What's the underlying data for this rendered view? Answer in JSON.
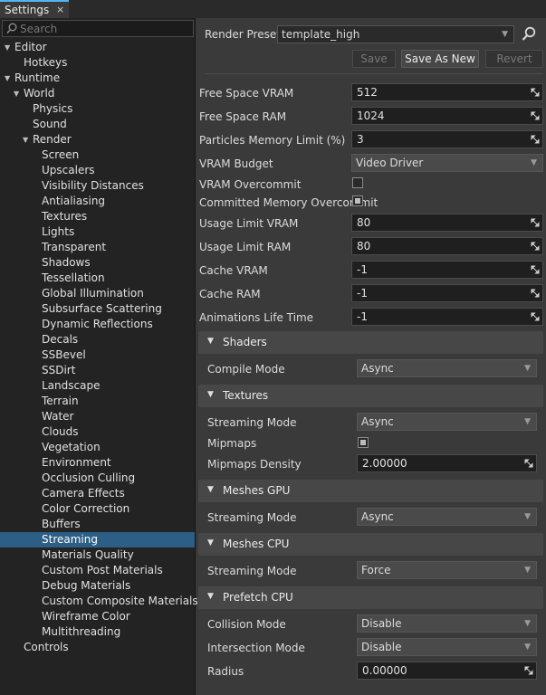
{
  "window": {
    "tab_title": "Settings",
    "tab_close": "×"
  },
  "search": {
    "placeholder": "Search"
  },
  "tree": [
    {
      "label": "Editor",
      "level": 0,
      "arrow": "down"
    },
    {
      "label": "Hotkeys",
      "level": 1
    },
    {
      "label": "Runtime",
      "level": 0,
      "arrow": "down"
    },
    {
      "label": "World",
      "level": 1,
      "arrow": "down"
    },
    {
      "label": "Physics",
      "level": 2
    },
    {
      "label": "Sound",
      "level": 2
    },
    {
      "label": "Render",
      "level": 2,
      "arrow": "down"
    },
    {
      "label": "Screen",
      "level": 3
    },
    {
      "label": "Upscalers",
      "level": 3
    },
    {
      "label": "Visibility Distances",
      "level": 3
    },
    {
      "label": "Antialiasing",
      "level": 3
    },
    {
      "label": "Textures",
      "level": 3
    },
    {
      "label": "Lights",
      "level": 3
    },
    {
      "label": "Transparent",
      "level": 3
    },
    {
      "label": "Shadows",
      "level": 3
    },
    {
      "label": "Tessellation",
      "level": 3
    },
    {
      "label": "Global Illumination",
      "level": 3
    },
    {
      "label": "Subsurface Scattering",
      "level": 3
    },
    {
      "label": "Dynamic Reflections",
      "level": 3
    },
    {
      "label": "Decals",
      "level": 3
    },
    {
      "label": "SSBevel",
      "level": 3
    },
    {
      "label": "SSDirt",
      "level": 3
    },
    {
      "label": "Landscape",
      "level": 3
    },
    {
      "label": "Terrain",
      "level": 3
    },
    {
      "label": "Water",
      "level": 3
    },
    {
      "label": "Clouds",
      "level": 3
    },
    {
      "label": "Vegetation",
      "level": 3
    },
    {
      "label": "Environment",
      "level": 3
    },
    {
      "label": "Occlusion Culling",
      "level": 3
    },
    {
      "label": "Camera Effects",
      "level": 3
    },
    {
      "label": "Color Correction",
      "level": 3
    },
    {
      "label": "Buffers",
      "level": 3
    },
    {
      "label": "Streaming",
      "level": 3,
      "selected": true
    },
    {
      "label": "Materials Quality",
      "level": 3
    },
    {
      "label": "Custom Post Materials",
      "level": 3
    },
    {
      "label": "Debug Materials",
      "level": 3
    },
    {
      "label": "Custom Composite Materials",
      "level": 3
    },
    {
      "label": "Wireframe Color",
      "level": 3
    },
    {
      "label": "Multithreading",
      "level": 3
    },
    {
      "label": "Controls",
      "level": 1
    }
  ],
  "preset": {
    "label": "Render Preset:",
    "value": "template_high",
    "save": "Save",
    "save_as_new": "Save As New",
    "revert": "Revert"
  },
  "params": {
    "free_space_vram": {
      "label": "Free Space VRAM",
      "value": "512"
    },
    "free_space_ram": {
      "label": "Free Space RAM",
      "value": "1024"
    },
    "particles_memory_limit": {
      "label": "Particles Memory Limit (%)",
      "value": "3"
    },
    "vram_budget": {
      "label": "VRAM Budget",
      "value": "Video Driver"
    },
    "vram_overcommit": {
      "label": "VRAM Overcommit",
      "checked": false
    },
    "committed_memory_overcommit": {
      "label": "Committed Memory Overcommit",
      "checked": true
    },
    "usage_limit_vram": {
      "label": "Usage Limit VRAM",
      "value": "80"
    },
    "usage_limit_ram": {
      "label": "Usage Limit RAM",
      "value": "80"
    },
    "cache_vram": {
      "label": "Cache VRAM",
      "value": "-1"
    },
    "cache_ram": {
      "label": "Cache RAM",
      "value": "-1"
    },
    "animations_life_time": {
      "label": "Animations Life Time",
      "value": "-1"
    }
  },
  "shaders": {
    "title": "Shaders",
    "compile_mode": {
      "label": "Compile Mode",
      "value": "Async"
    }
  },
  "textures": {
    "title": "Textures",
    "streaming_mode": {
      "label": "Streaming Mode",
      "value": "Async"
    },
    "mipmaps": {
      "label": "Mipmaps",
      "checked": true
    },
    "mipmaps_density": {
      "label": "Mipmaps Density",
      "value": "2.00000"
    }
  },
  "meshes_gpu": {
    "title": "Meshes GPU",
    "streaming_mode": {
      "label": "Streaming Mode",
      "value": "Async"
    }
  },
  "meshes_cpu": {
    "title": "Meshes CPU",
    "streaming_mode": {
      "label": "Streaming Mode",
      "value": "Force"
    }
  },
  "prefetch_cpu": {
    "title": "Prefetch CPU",
    "collision_mode": {
      "label": "Collision Mode",
      "value": "Disable"
    },
    "intersection_mode": {
      "label": "Intersection Mode",
      "value": "Disable"
    },
    "radius": {
      "label": "Radius",
      "value": "0.00000"
    }
  }
}
